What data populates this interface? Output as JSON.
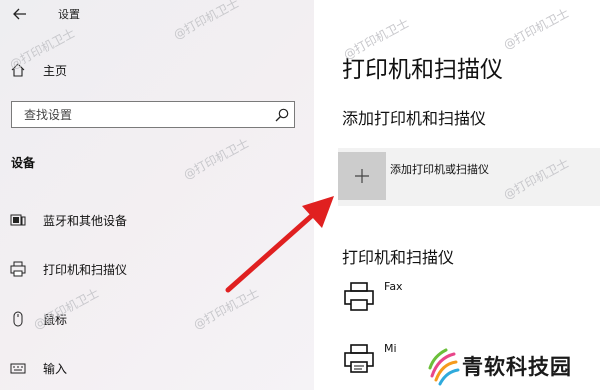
{
  "window": {
    "title": "设置"
  },
  "sidebar": {
    "home_label": "主页",
    "search": {
      "placeholder": "查找设置"
    },
    "section_label": "设备",
    "items": [
      {
        "label": "蓝牙和其他设备",
        "icon": "bluetooth-devices-icon"
      },
      {
        "label": "打印机和扫描仪",
        "icon": "printer-icon"
      },
      {
        "label": "鼠标",
        "icon": "mouse-icon"
      },
      {
        "label": "输入",
        "icon": "keyboard-icon"
      }
    ]
  },
  "main": {
    "page_title": "打印机和扫描仪",
    "add_section_title": "添加打印机和扫描仪",
    "add_button_label": "添加打印机或扫描仪",
    "list_title": "打印机和扫描仪",
    "devices": [
      {
        "name": "Fax",
        "icon": "fax-icon"
      },
      {
        "name": "Mi",
        "icon": "printer-icon"
      }
    ]
  },
  "watermark_text": "@打印机卫士",
  "branding": {
    "logo_text": "青软科技园"
  },
  "colors": {
    "arrow": "#e02020",
    "add_tile": "#cccccc",
    "sidebar_bg": "#eeeef1"
  }
}
